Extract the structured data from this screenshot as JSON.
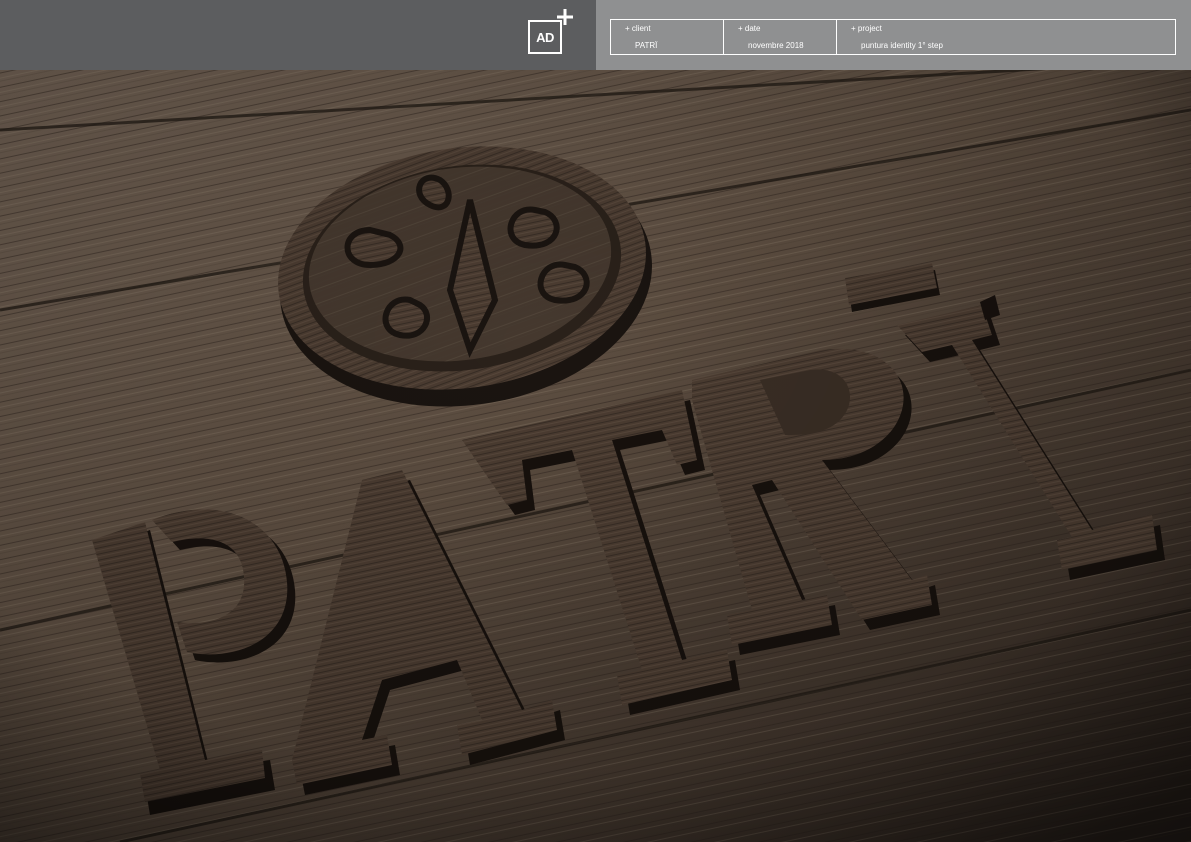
{
  "header": {
    "logo": {
      "text": "AD",
      "icon": "plus-icon"
    },
    "info": [
      {
        "label": "+ client",
        "value": "PATRÏ"
      },
      {
        "label": "+ date",
        "value": "novembre 2018"
      },
      {
        "label": "+ project",
        "value": "puntura identity 1° step"
      }
    ]
  },
  "scene": {
    "brand_word": "PATRÏ",
    "emblem_icon": "swirl-emblem-icon",
    "colors": {
      "wood_dark": "#2a211b",
      "wood_mid": "#5a4a3d",
      "wood_light": "#8a7867",
      "letter_face": "#4a3b30",
      "letter_side": "#1a1410"
    }
  }
}
